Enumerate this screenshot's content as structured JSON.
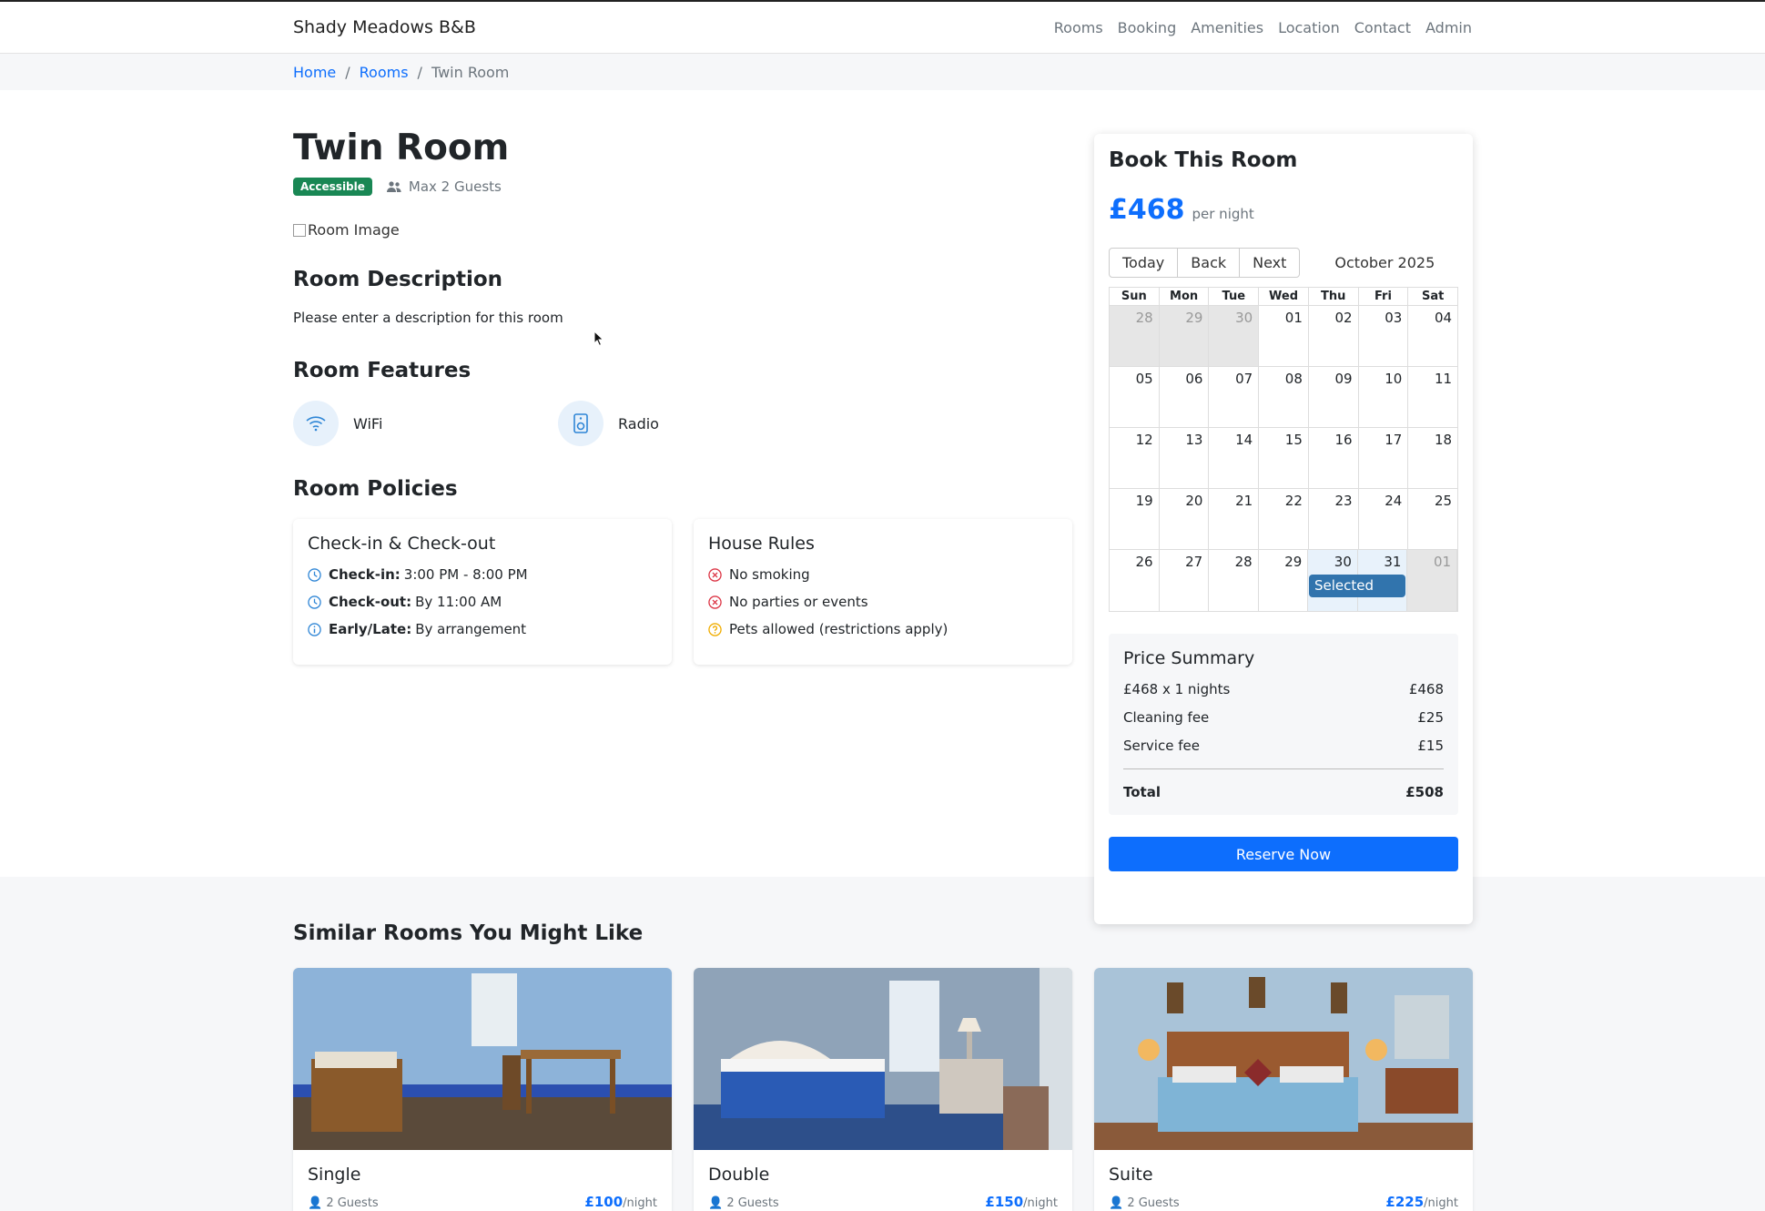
{
  "nav": {
    "brand": "Shady Meadows B&B",
    "links": [
      "Rooms",
      "Booking",
      "Amenities",
      "Location",
      "Contact",
      "Admin"
    ]
  },
  "breadcrumb": [
    "Home",
    "Rooms",
    "Twin Room"
  ],
  "room": {
    "title": "Twin Room",
    "badge": "Accessible",
    "guests": "Max 2 Guests",
    "image_alt": "Room Image",
    "description_heading": "Room Description",
    "description": "Please enter a description for this room",
    "features_heading": "Room Features",
    "features": [
      {
        "label": "WiFi",
        "icon": "wifi-icon"
      },
      {
        "label": "Radio",
        "icon": "speaker-icon"
      }
    ],
    "policies_heading": "Room Policies",
    "checkin_card": {
      "title": "Check-in & Check-out",
      "lines": [
        {
          "label": "Check-in:",
          "value": "3:00 PM - 8:00 PM",
          "icon": "clock-icon"
        },
        {
          "label": "Check-out:",
          "value": "By 11:00 AM",
          "icon": "clock-icon"
        },
        {
          "label": "Early/Late:",
          "value": "By arrangement",
          "icon": "info-icon"
        }
      ]
    },
    "rules_card": {
      "title": "House Rules",
      "lines": [
        {
          "text": "No smoking",
          "icon": "x-circle-icon"
        },
        {
          "text": "No parties or events",
          "icon": "x-circle-icon"
        },
        {
          "text": "Pets allowed (restrictions apply)",
          "icon": "question-circle-icon"
        }
      ]
    }
  },
  "booking": {
    "heading": "Book This Room",
    "price": "£468",
    "per_night": "per night",
    "buttons": [
      "Today",
      "Back",
      "Next"
    ],
    "month": "October 2025",
    "weekdays": [
      "Sun",
      "Mon",
      "Tue",
      "Wed",
      "Thu",
      "Fri",
      "Sat"
    ],
    "weeks": [
      [
        "28",
        "29",
        "30",
        "01",
        "02",
        "03",
        "04"
      ],
      [
        "05",
        "06",
        "07",
        "08",
        "09",
        "10",
        "11"
      ],
      [
        "12",
        "13",
        "14",
        "15",
        "16",
        "17",
        "18"
      ],
      [
        "19",
        "20",
        "21",
        "22",
        "23",
        "24",
        "25"
      ],
      [
        "26",
        "27",
        "28",
        "29",
        "30",
        "31",
        "01"
      ]
    ],
    "selected_label": "Selected",
    "summary": {
      "heading": "Price Summary",
      "rows": [
        {
          "label": "£468 x 1 nights",
          "value": "£468"
        },
        {
          "label": "Cleaning fee",
          "value": "£25"
        },
        {
          "label": "Service fee",
          "value": "£15"
        }
      ],
      "total_label": "Total",
      "total_value": "£508"
    },
    "reserve_label": "Reserve Now"
  },
  "similar": {
    "heading": "Similar Rooms You Might Like",
    "rooms": [
      {
        "name": "Single",
        "guests": "2 Guests",
        "price": "£100",
        "per": "/night"
      },
      {
        "name": "Double",
        "guests": "2 Guests",
        "price": "£150",
        "per": "/night"
      },
      {
        "name": "Suite",
        "guests": "2 Guests",
        "price": "£225",
        "per": "/night"
      }
    ]
  },
  "colors": {
    "accent": "#0d6efd",
    "badge": "#198754",
    "selected_event": "#3174ad"
  }
}
